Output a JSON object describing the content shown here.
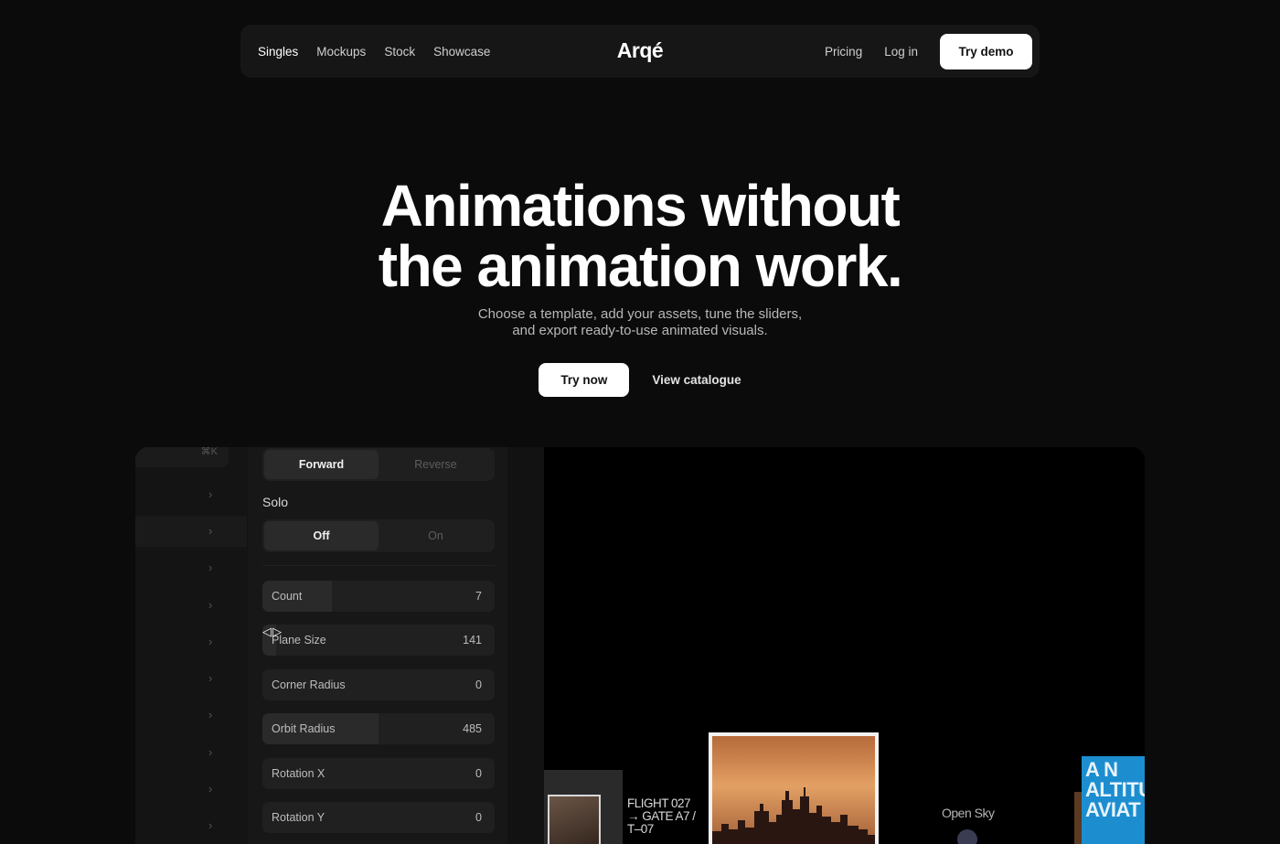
{
  "nav": {
    "left_links": [
      "Singles",
      "Mockups",
      "Stock",
      "Showcase"
    ],
    "logo": "Arqé",
    "right_links": [
      "Pricing",
      "Log in"
    ],
    "cta": "Try demo"
  },
  "hero": {
    "title_lines": [
      "Animations without",
      "the animation work."
    ],
    "subtitle_lines": [
      "Choose a template, add your assets, tune the sliders,",
      "and export ready-to-use animated visuals."
    ],
    "primary_cta": "Try now",
    "secondary_cta": "View catalogue"
  },
  "preview": {
    "sidebar": {
      "shortcut": "⌘K",
      "chevron": "›"
    },
    "direction": {
      "options": [
        "Forward",
        "Reverse"
      ],
      "selected": "Forward"
    },
    "solo": {
      "label": "Solo",
      "options": [
        "Off",
        "On"
      ],
      "selected": "Off"
    },
    "cursor": "◁▷",
    "sliders": [
      {
        "label": "Count",
        "value": "7",
        "fill": 0.3
      },
      {
        "label": "Plane Size",
        "value": "141",
        "fill": 0.06
      },
      {
        "label": "Corner Radius",
        "value": "0",
        "fill": 0
      },
      {
        "label": "Orbit Radius",
        "value": "485",
        "fill": 0.5
      },
      {
        "label": "Rotation X",
        "value": "0",
        "fill": 0
      },
      {
        "label": "Rotation Y",
        "value": "0",
        "fill": 0
      }
    ],
    "canvas": {
      "flight_lines": [
        "FLIGHT 027",
        "→ GATE A7 /",
        "T–07"
      ],
      "open_sky": "Open Sky",
      "poster_lines": [
        "A N",
        "ALTITU",
        "AVIAT"
      ]
    }
  }
}
